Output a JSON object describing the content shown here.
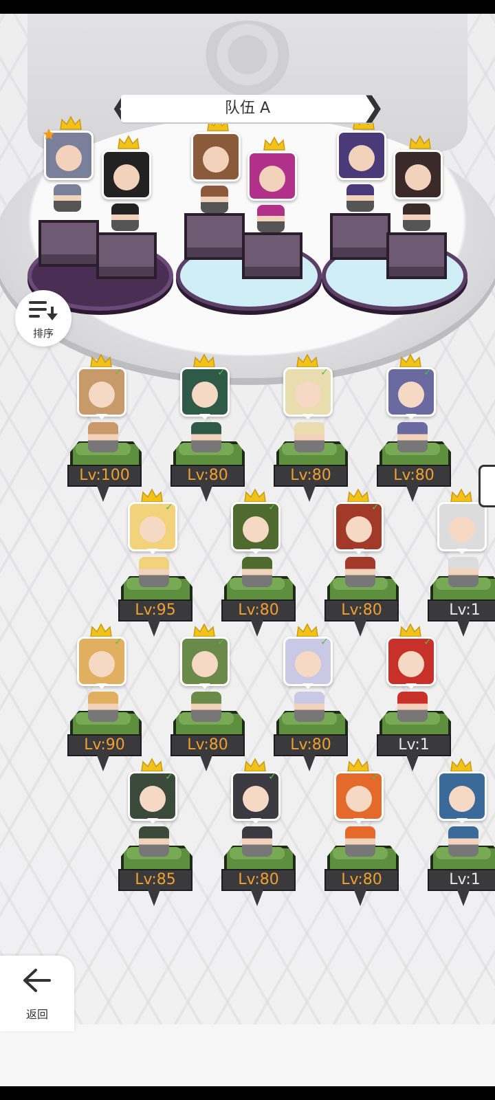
{
  "header": {
    "team_title": "队伍 A"
  },
  "buttons": {
    "sort_label": "排序",
    "back_label": "返回",
    "sort_icon": "sort-icon",
    "back_icon": "arrow-left-icon"
  },
  "colors": {
    "level_text": "#f0a030",
    "pedestal": "#5d8f3f",
    "crown": "#f3c21a",
    "tick": "#55c044"
  },
  "team": [
    {
      "slot": 1,
      "rank_star": true,
      "portrait": "grey-bearded-warrior"
    },
    {
      "slot": 2,
      "rank_star": false,
      "portrait": "dark-haired-masked"
    },
    {
      "slot": 3,
      "rank_star": false,
      "portrait": "brown-haired-girl"
    },
    {
      "slot": 4,
      "rank_star": false,
      "portrait": "pink-haired-girl"
    },
    {
      "slot": 5,
      "rank_star": false,
      "portrait": "purple-haired-girl"
    },
    {
      "slot": 6,
      "rank_star": false,
      "portrait": "dark-skinned-hero"
    }
  ],
  "roster": [
    {
      "level": "Lv:100",
      "color": "#c89a6a"
    },
    {
      "level": "Lv:80",
      "color": "#2f5a48"
    },
    {
      "level": "Lv:80",
      "color": "#e9dcae"
    },
    {
      "level": "Lv:80",
      "color": "#6a6aa0"
    },
    {
      "level": "Lv:95",
      "color": "#f2d27a"
    },
    {
      "level": "Lv:80",
      "color": "#4e6a2e"
    },
    {
      "level": "Lv:80",
      "color": "#a23a2a"
    },
    {
      "level": "Lv:1",
      "color": "#dcdcdc"
    },
    {
      "level": "Lv:90",
      "color": "#e0b060"
    },
    {
      "level": "Lv:80",
      "color": "#6a8a4a"
    },
    {
      "level": "Lv:80",
      "color": "#c9c9e6"
    },
    {
      "level": "Lv:1",
      "color": "#c8302a"
    },
    {
      "level": "Lv:85",
      "color": "#3c4a3c"
    },
    {
      "level": "Lv:80",
      "color": "#3a3a40"
    },
    {
      "level": "Lv:80",
      "color": "#e36a2a"
    },
    {
      "level": "Lv:1",
      "color": "#3a6a9a"
    }
  ]
}
